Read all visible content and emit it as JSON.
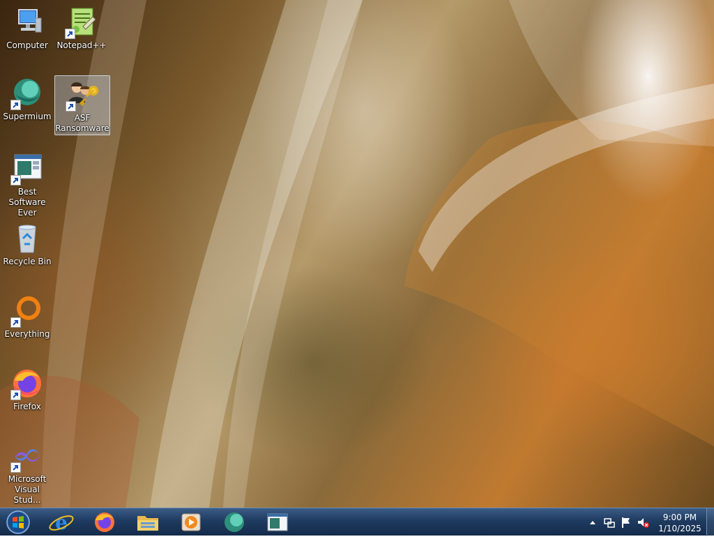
{
  "desktop": {
    "icons": [
      {
        "label": "Computer",
        "icon": "computer-icon"
      },
      {
        "label": "Notepad++",
        "icon": "notepadpp-icon"
      },
      {
        "label": "Supermium",
        "icon": "supermium-icon"
      },
      {
        "label": "ASF Ransomware",
        "icon": "asf-ransomware-icon",
        "selected": true
      },
      {
        "label": "Best Software Ever",
        "icon": "best-software-icon"
      },
      {
        "label": "Recycle Bin",
        "icon": "recycle-bin-icon"
      },
      {
        "label": "Everything",
        "icon": "everything-icon"
      },
      {
        "label": "Firefox",
        "icon": "firefox-icon"
      },
      {
        "label": "Microsoft Visual Stud...",
        "icon": "visual-studio-icon"
      }
    ]
  },
  "taskbar": {
    "pinned": [
      "internet-explorer-icon",
      "firefox-icon",
      "file-explorer-icon",
      "media-player-icon",
      "supermium-icon",
      "best-software-icon"
    ],
    "tray": [
      "show-hidden-icons-icon",
      "network-icon",
      "action-center-flag-icon",
      "volume-muted-icon"
    ],
    "clock": {
      "time": "9:00 PM",
      "date": "1/10/2025"
    }
  },
  "colors": {
    "taskbar": "#1f3b60",
    "accent": "#f08010"
  }
}
